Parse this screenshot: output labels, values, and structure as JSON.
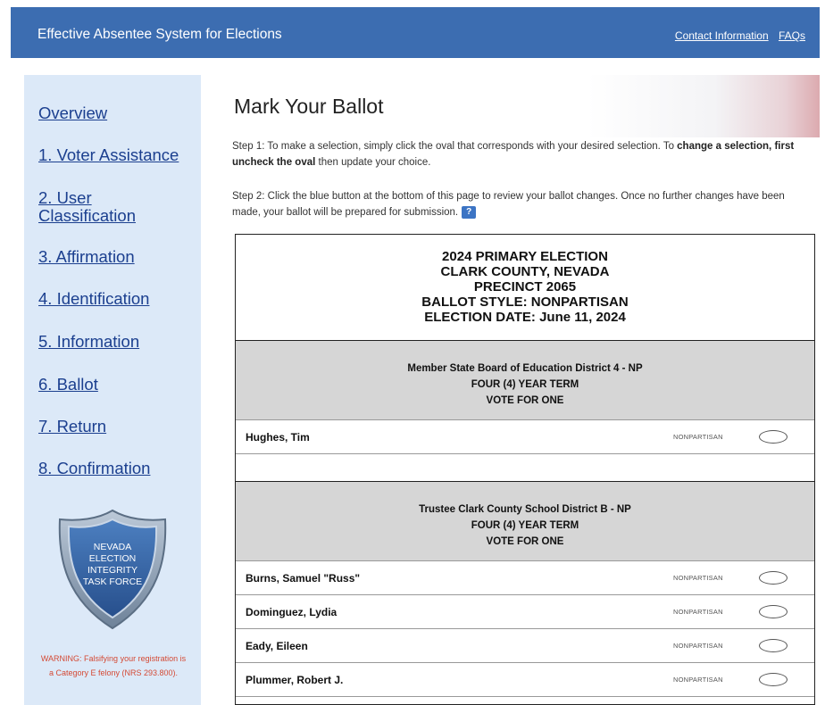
{
  "header": {
    "title": "Effective Absentee System for Elections",
    "links": [
      "Contact Information",
      "FAQs"
    ]
  },
  "sidebar": {
    "items": [
      {
        "label": "Overview"
      },
      {
        "label": "1. Voter Assistance"
      },
      {
        "label": "2. User Classification"
      },
      {
        "label": "3. Affirmation"
      },
      {
        "label": "4. Identification"
      },
      {
        "label": "5. Information"
      },
      {
        "label": "6. Ballot"
      },
      {
        "label": "7. Return"
      },
      {
        "label": "8. Confirmation"
      }
    ],
    "badge": [
      "NEVADA",
      "ELECTION",
      "INTEGRITY",
      "TASK FORCE"
    ],
    "warning": "WARNING: Falsifying your registration is a Category E felony (NRS 293.800)."
  },
  "main": {
    "title": "Mark Your Ballot",
    "step1_text": "Step 1:  To make a selection, simply click the oval that corresponds with your desired selection. To ",
    "step1_bold": "change a selection, first uncheck the oval",
    "step1_tail": " then update your choice.",
    "step2_text": "Step 2:  Click the blue button at the bottom of this page to review your ballot changes. Once no further changes have been made, your ballot will be prepared for submission.",
    "help_icon": "?"
  },
  "ballot": {
    "header_lines": [
      "2024 PRIMARY ELECTION",
      "CLARK COUNTY, NEVADA",
      "PRECINCT 2065",
      "BALLOT STYLE: NONPARTISAN",
      "ELECTION DATE: June 11, 2024"
    ],
    "contests": [
      {
        "lines": [
          "Member State Board of Education District 4 - NP",
          "FOUR (4) YEAR TERM",
          "VOTE FOR ONE"
        ],
        "candidates": [
          {
            "name": "Hughes, Tim",
            "party": "NONPARTISAN"
          }
        ]
      },
      {
        "lines": [
          "Trustee Clark County School District B - NP",
          "FOUR (4) YEAR TERM",
          "VOTE FOR ONE"
        ],
        "candidates": [
          {
            "name": "Burns, Samuel \"Russ\"",
            "party": "NONPARTISAN"
          },
          {
            "name": "Dominguez, Lydia",
            "party": "NONPARTISAN"
          },
          {
            "name": "Eady, Eileen",
            "party": "NONPARTISAN"
          },
          {
            "name": "Plummer, Robert J.",
            "party": "NONPARTISAN"
          }
        ]
      }
    ]
  },
  "colors": {
    "header_bg": "#3c6db1",
    "sidebar_bg": "#dce9f8",
    "nav_link": "#1b3f8f",
    "contest_bg": "#d6d6d6",
    "warning": "#d44a35"
  }
}
